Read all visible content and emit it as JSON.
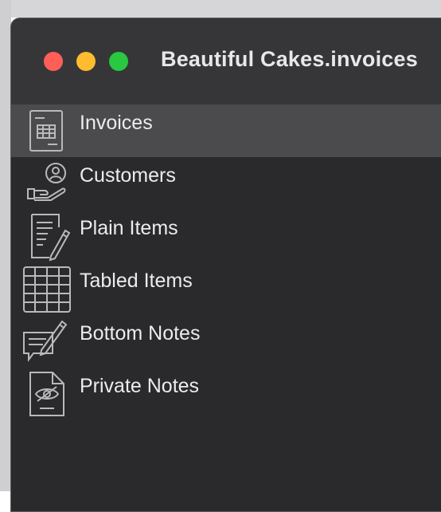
{
  "window": {
    "title": "Beautiful Cakes.invoices"
  },
  "sidebar": {
    "items": [
      {
        "label": "Invoices",
        "icon": "invoice-document-icon",
        "selected": true
      },
      {
        "label": "Customers",
        "icon": "customer-hand-icon",
        "selected": false
      },
      {
        "label": "Plain Items",
        "icon": "document-pencil-icon",
        "selected": false
      },
      {
        "label": "Tabled Items",
        "icon": "table-grid-icon",
        "selected": false
      },
      {
        "label": "Bottom Notes",
        "icon": "note-pencil-icon",
        "selected": false
      },
      {
        "label": "Private Notes",
        "icon": "hidden-eye-document-icon",
        "selected": false
      }
    ]
  },
  "colors": {
    "close": "#ff5f57",
    "minimize": "#febc2e",
    "zoom": "#28c840",
    "selected_row": "#4b4b4d"
  }
}
